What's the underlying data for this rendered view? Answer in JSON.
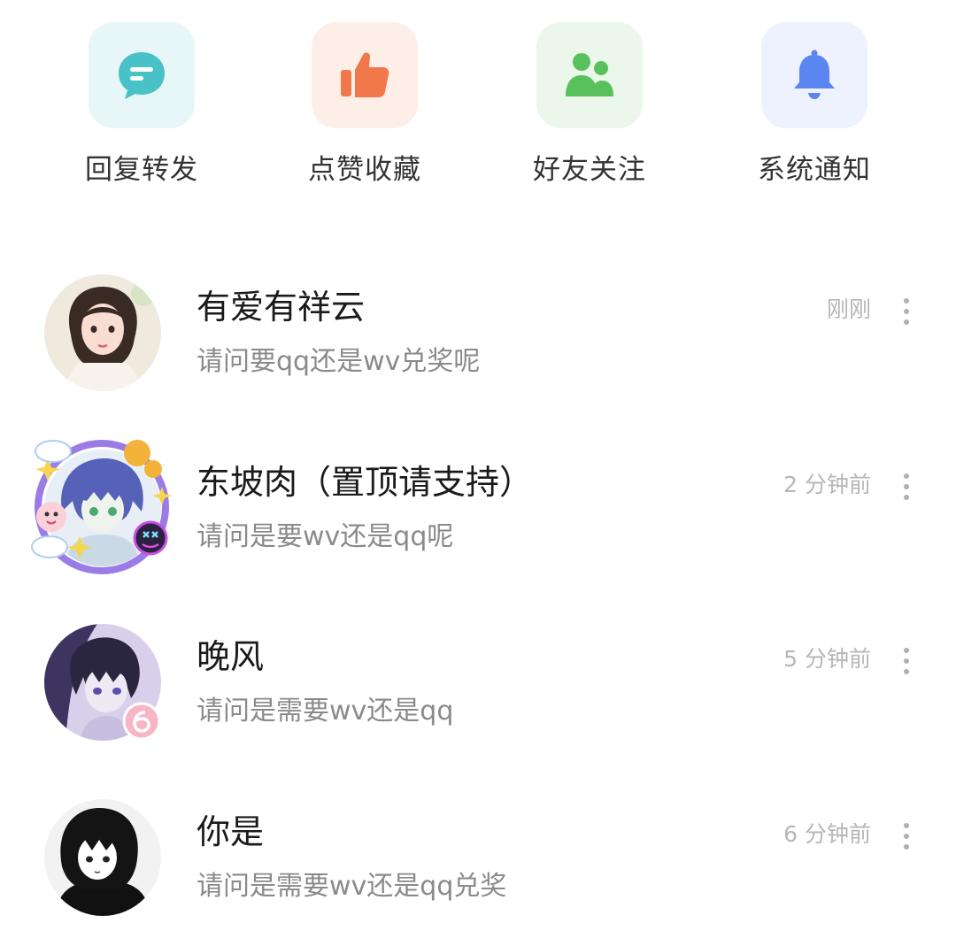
{
  "quick_entries": [
    {
      "label": "回复转发",
      "icon": "reply-forward-icon",
      "tile_color": "#e7f6f7",
      "icon_color": "#48c2c7"
    },
    {
      "label": "点赞收藏",
      "icon": "thumbs-up-icon",
      "tile_color": "#fdefe8",
      "icon_color": "#f0784a"
    },
    {
      "label": "好友关注",
      "icon": "friends-icon",
      "tile_color": "#eaf7ea",
      "icon_color": "#58c15b"
    },
    {
      "label": "系统通知",
      "icon": "bell-icon",
      "tile_color": "#eef1fe",
      "icon_color": "#5b86f1"
    }
  ],
  "messages": [
    {
      "name": "有爱有祥云",
      "preview": "请问要qq还是wv兑奖呢",
      "time": "刚刚",
      "avatar": "girl-portrait-avatar"
    },
    {
      "name": "东坡肉（置顶请支持）",
      "preview": "请问是要wv还是qq呢",
      "time": "2 分钟前",
      "avatar": "anime-boy-framed-avatar"
    },
    {
      "name": "晚风",
      "preview": "请问是需要wv还是qq",
      "time": "5 分钟前",
      "avatar": "anime-boy-purple-avatar"
    },
    {
      "name": "你是",
      "preview": "请问是需要wv还是qq兑奖",
      "time": "6 分钟前",
      "avatar": "anime-girl-bw-avatar"
    }
  ],
  "colors": {
    "title_text": "#1a1a1a",
    "preview_text": "#8a8a8a",
    "time_text": "#b6b6b6",
    "more_dots": "#b0b0b0"
  }
}
